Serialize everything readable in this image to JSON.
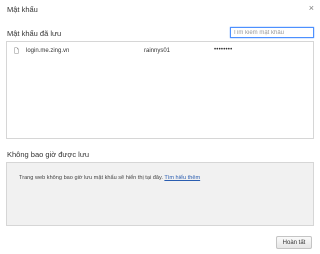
{
  "dialog": {
    "title": "Mật khẩu",
    "close_glyph": "×"
  },
  "saved": {
    "heading": "Mật khẩu đã lưu",
    "search_placeholder": "Tìm kiếm mật khẩu",
    "entries": [
      {
        "site": "login.me.zing.vn",
        "username": "rainnys01",
        "password": "••••••••"
      }
    ]
  },
  "never": {
    "heading": "Không bao giờ được lưu",
    "message": "Trang web không bao giờ lưu mật khẩu sẽ hiển thị tại đây.",
    "link": "Tìm hiểu thêm"
  },
  "footer": {
    "done_label": "Hoàn tất"
  }
}
